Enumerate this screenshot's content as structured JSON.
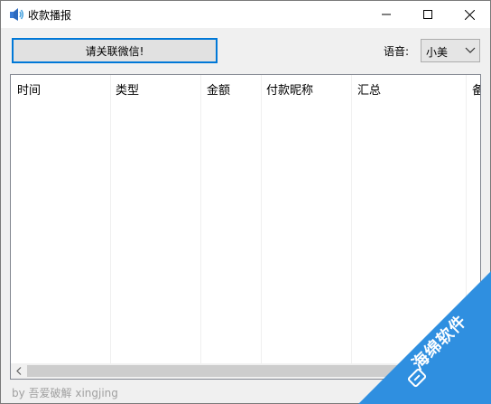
{
  "window": {
    "title": "收款播报",
    "icon": "app-speaker-icon"
  },
  "toolbar": {
    "follow_button_label": "请关联微信!",
    "voice_label": "语音:",
    "voice_selected": "小美"
  },
  "table": {
    "columns": [
      "时间",
      "类型",
      "金额",
      "付款昵称",
      "汇总",
      "备"
    ],
    "rows": []
  },
  "footer": {
    "credit": "by 吾爱破解 xingjing"
  },
  "watermark": {
    "text": "海绵软件"
  },
  "colors": {
    "accent": "#0078d7",
    "watermark": "#2f8fe0"
  }
}
